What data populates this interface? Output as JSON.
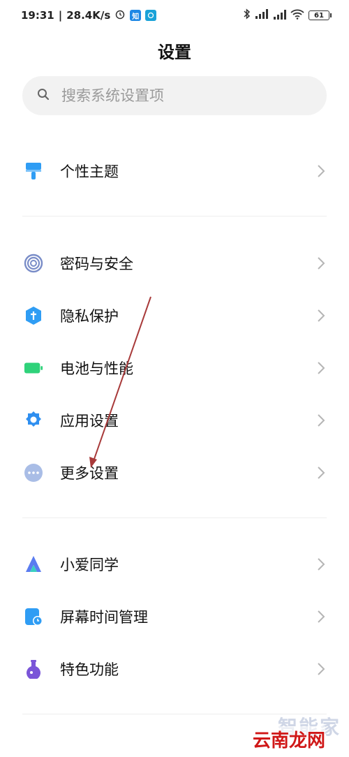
{
  "status": {
    "time": "19:31",
    "net_speed": "28.4K/s",
    "app_badge_1": "知",
    "battery": "61"
  },
  "page": {
    "title": "设置"
  },
  "search": {
    "placeholder": "搜索系统设置项"
  },
  "sections": [
    {
      "items": [
        {
          "label": "个性主题",
          "icon": "brush-icon",
          "color": "#2f9df4"
        }
      ]
    },
    {
      "items": [
        {
          "label": "密码与安全",
          "icon": "fingerprint-icon",
          "color": "#7a8dc8"
        },
        {
          "label": "隐私保护",
          "icon": "privacy-shield-icon",
          "color": "#2f9df4"
        },
        {
          "label": "电池与性能",
          "icon": "battery-icon",
          "color": "#2fd27a"
        },
        {
          "label": "应用设置",
          "icon": "gear-icon",
          "color": "#2f8ff0"
        },
        {
          "label": "更多设置",
          "icon": "more-dots-icon",
          "color": "#a9bde6"
        }
      ]
    },
    {
      "items": [
        {
          "label": "小爱同学",
          "icon": "xiaoai-icon",
          "color": "#5a7cf0"
        },
        {
          "label": "屏幕时间管理",
          "icon": "screen-time-icon",
          "color": "#2f9df4"
        },
        {
          "label": "特色功能",
          "icon": "flask-icon",
          "color": "#7a55d8"
        }
      ]
    }
  ],
  "watermark": {
    "text1": "智能家",
    "text2": "云南龙网"
  },
  "colors": {
    "chevron": "#b5b5b5",
    "annotation_arrow": "#a83a3a"
  }
}
